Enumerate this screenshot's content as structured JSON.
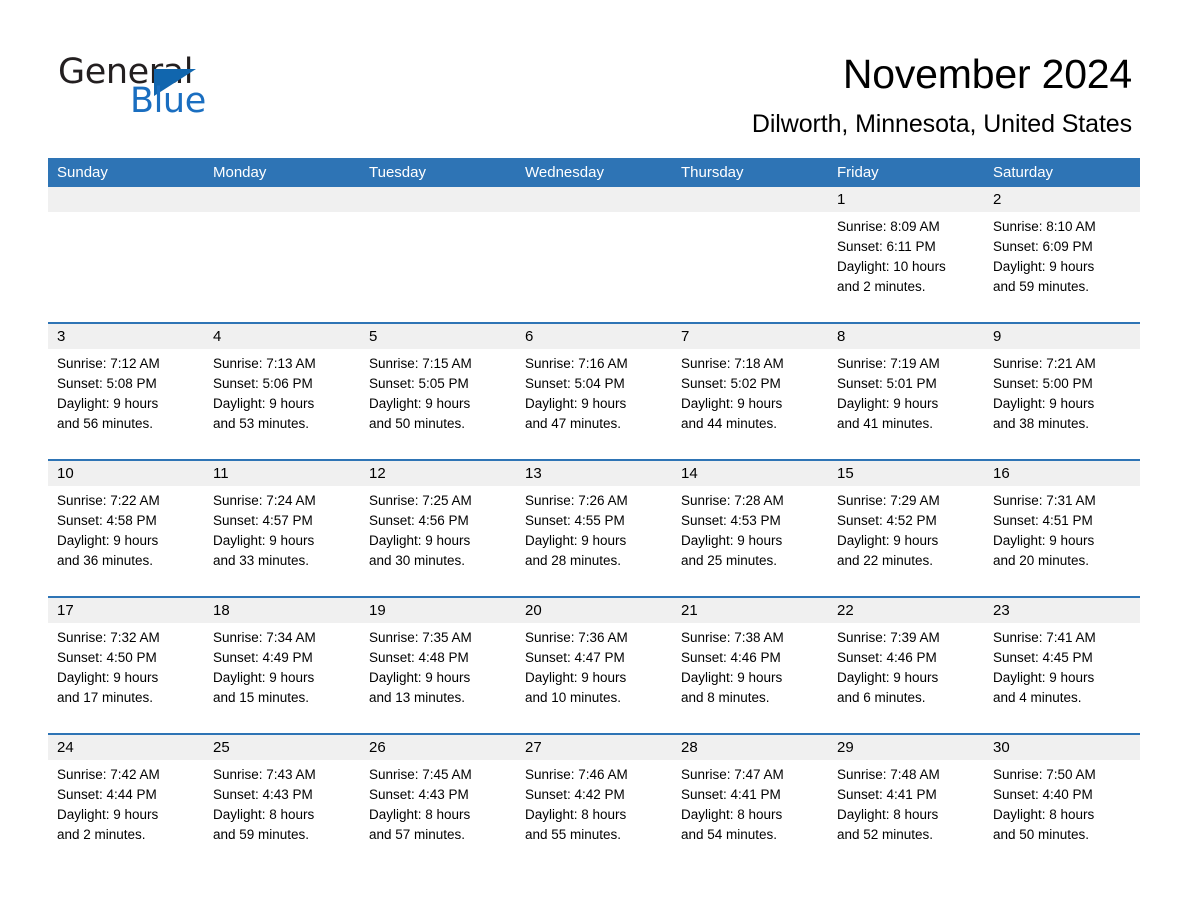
{
  "brand": {
    "name_part1": "General",
    "name_part2": "Blue",
    "accent_color": "#1166ae"
  },
  "header": {
    "month_title": "November 2024",
    "location": "Dilworth, Minnesota, United States"
  },
  "theme": {
    "header_blue": "#2e74b5",
    "date_band_gray": "#f0f0f0",
    "cell_white": "#ffffff"
  },
  "weekdays": [
    "Sunday",
    "Monday",
    "Tuesday",
    "Wednesday",
    "Thursday",
    "Friday",
    "Saturday"
  ],
  "weeks": [
    [
      {
        "day": "",
        "lines": []
      },
      {
        "day": "",
        "lines": []
      },
      {
        "day": "",
        "lines": []
      },
      {
        "day": "",
        "lines": []
      },
      {
        "day": "",
        "lines": []
      },
      {
        "day": "1",
        "lines": [
          "Sunrise: 8:09 AM",
          "Sunset: 6:11 PM",
          "Daylight: 10 hours",
          "and 2 minutes."
        ]
      },
      {
        "day": "2",
        "lines": [
          "Sunrise: 8:10 AM",
          "Sunset: 6:09 PM",
          "Daylight: 9 hours",
          "and 59 minutes."
        ]
      }
    ],
    [
      {
        "day": "3",
        "lines": [
          "Sunrise: 7:12 AM",
          "Sunset: 5:08 PM",
          "Daylight: 9 hours",
          "and 56 minutes."
        ]
      },
      {
        "day": "4",
        "lines": [
          "Sunrise: 7:13 AM",
          "Sunset: 5:06 PM",
          "Daylight: 9 hours",
          "and 53 minutes."
        ]
      },
      {
        "day": "5",
        "lines": [
          "Sunrise: 7:15 AM",
          "Sunset: 5:05 PM",
          "Daylight: 9 hours",
          "and 50 minutes."
        ]
      },
      {
        "day": "6",
        "lines": [
          "Sunrise: 7:16 AM",
          "Sunset: 5:04 PM",
          "Daylight: 9 hours",
          "and 47 minutes."
        ]
      },
      {
        "day": "7",
        "lines": [
          "Sunrise: 7:18 AM",
          "Sunset: 5:02 PM",
          "Daylight: 9 hours",
          "and 44 minutes."
        ]
      },
      {
        "day": "8",
        "lines": [
          "Sunrise: 7:19 AM",
          "Sunset: 5:01 PM",
          "Daylight: 9 hours",
          "and 41 minutes."
        ]
      },
      {
        "day": "9",
        "lines": [
          "Sunrise: 7:21 AM",
          "Sunset: 5:00 PM",
          "Daylight: 9 hours",
          "and 38 minutes."
        ]
      }
    ],
    [
      {
        "day": "10",
        "lines": [
          "Sunrise: 7:22 AM",
          "Sunset: 4:58 PM",
          "Daylight: 9 hours",
          "and 36 minutes."
        ]
      },
      {
        "day": "11",
        "lines": [
          "Sunrise: 7:24 AM",
          "Sunset: 4:57 PM",
          "Daylight: 9 hours",
          "and 33 minutes."
        ]
      },
      {
        "day": "12",
        "lines": [
          "Sunrise: 7:25 AM",
          "Sunset: 4:56 PM",
          "Daylight: 9 hours",
          "and 30 minutes."
        ]
      },
      {
        "day": "13",
        "lines": [
          "Sunrise: 7:26 AM",
          "Sunset: 4:55 PM",
          "Daylight: 9 hours",
          "and 28 minutes."
        ]
      },
      {
        "day": "14",
        "lines": [
          "Sunrise: 7:28 AM",
          "Sunset: 4:53 PM",
          "Daylight: 9 hours",
          "and 25 minutes."
        ]
      },
      {
        "day": "15",
        "lines": [
          "Sunrise: 7:29 AM",
          "Sunset: 4:52 PM",
          "Daylight: 9 hours",
          "and 22 minutes."
        ]
      },
      {
        "day": "16",
        "lines": [
          "Sunrise: 7:31 AM",
          "Sunset: 4:51 PM",
          "Daylight: 9 hours",
          "and 20 minutes."
        ]
      }
    ],
    [
      {
        "day": "17",
        "lines": [
          "Sunrise: 7:32 AM",
          "Sunset: 4:50 PM",
          "Daylight: 9 hours",
          "and 17 minutes."
        ]
      },
      {
        "day": "18",
        "lines": [
          "Sunrise: 7:34 AM",
          "Sunset: 4:49 PM",
          "Daylight: 9 hours",
          "and 15 minutes."
        ]
      },
      {
        "day": "19",
        "lines": [
          "Sunrise: 7:35 AM",
          "Sunset: 4:48 PM",
          "Daylight: 9 hours",
          "and 13 minutes."
        ]
      },
      {
        "day": "20",
        "lines": [
          "Sunrise: 7:36 AM",
          "Sunset: 4:47 PM",
          "Daylight: 9 hours",
          "and 10 minutes."
        ]
      },
      {
        "day": "21",
        "lines": [
          "Sunrise: 7:38 AM",
          "Sunset: 4:46 PM",
          "Daylight: 9 hours",
          "and 8 minutes."
        ]
      },
      {
        "day": "22",
        "lines": [
          "Sunrise: 7:39 AM",
          "Sunset: 4:46 PM",
          "Daylight: 9 hours",
          "and 6 minutes."
        ]
      },
      {
        "day": "23",
        "lines": [
          "Sunrise: 7:41 AM",
          "Sunset: 4:45 PM",
          "Daylight: 9 hours",
          "and 4 minutes."
        ]
      }
    ],
    [
      {
        "day": "24",
        "lines": [
          "Sunrise: 7:42 AM",
          "Sunset: 4:44 PM",
          "Daylight: 9 hours",
          "and 2 minutes."
        ]
      },
      {
        "day": "25",
        "lines": [
          "Sunrise: 7:43 AM",
          "Sunset: 4:43 PM",
          "Daylight: 8 hours",
          "and 59 minutes."
        ]
      },
      {
        "day": "26",
        "lines": [
          "Sunrise: 7:45 AM",
          "Sunset: 4:43 PM",
          "Daylight: 8 hours",
          "and 57 minutes."
        ]
      },
      {
        "day": "27",
        "lines": [
          "Sunrise: 7:46 AM",
          "Sunset: 4:42 PM",
          "Daylight: 8 hours",
          "and 55 minutes."
        ]
      },
      {
        "day": "28",
        "lines": [
          "Sunrise: 7:47 AM",
          "Sunset: 4:41 PM",
          "Daylight: 8 hours",
          "and 54 minutes."
        ]
      },
      {
        "day": "29",
        "lines": [
          "Sunrise: 7:48 AM",
          "Sunset: 4:41 PM",
          "Daylight: 8 hours",
          "and 52 minutes."
        ]
      },
      {
        "day": "30",
        "lines": [
          "Sunrise: 7:50 AM",
          "Sunset: 4:40 PM",
          "Daylight: 8 hours",
          "and 50 minutes."
        ]
      }
    ]
  ]
}
